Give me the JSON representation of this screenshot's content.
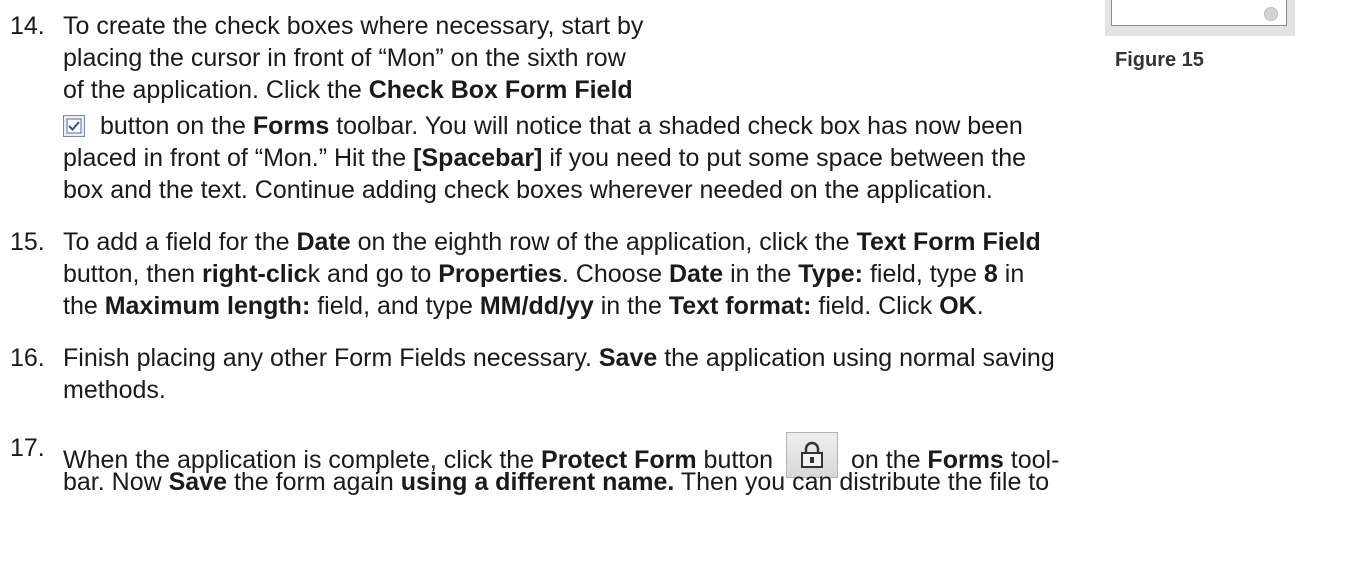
{
  "figure": {
    "caption": "Figure 15"
  },
  "steps": [
    {
      "number": "14.",
      "lines": [
        [
          "To create the check boxes where necessary, start by"
        ],
        [
          "placing the cursor in front of “Mon” on the sixth row"
        ],
        [
          "of the application. Click the ",
          "Check Box Form Field"
        ],
        [
          " button on the ",
          "Forms",
          " toolbar. You will notice that a shaded check box has now been"
        ],
        [
          "placed in front of “Mon.” Hit the ",
          "[Spacebar]",
          " if you need to put some space between the"
        ],
        [
          "box and the text. Continue adding check boxes wherever needed on the application."
        ]
      ]
    },
    {
      "number": "15.",
      "lines": [
        [
          "To add a field for the ",
          "Date",
          " on the eighth row of the application, click the ",
          "Text Form Field"
        ],
        [
          "button, then ",
          "right-clic",
          "k and go to ",
          "Properties",
          ". Choose ",
          "Date",
          " in the ",
          "Type:",
          " field, type ",
          "8",
          " in"
        ],
        [
          "the ",
          "Maximum length:",
          " field, and type ",
          "MM/dd/yy",
          " in the ",
          "Text format:",
          " field. Click ",
          "OK",
          "."
        ]
      ]
    },
    {
      "number": "16.",
      "lines": [
        [
          "Finish placing any other Form Fields necessary. ",
          "Save",
          " the application using normal saving"
        ],
        [
          "methods."
        ]
      ]
    },
    {
      "number": "17.",
      "lines": [
        [
          "When the application is complete, click the ",
          "Protect Form",
          " button ",
          "",
          " on the ",
          "Forms",
          " tool-"
        ],
        [
          "bar. Now ",
          "Save",
          " the form again ",
          "using a different name.",
          " Then you can distribute the file to"
        ]
      ]
    }
  ],
  "icons": {
    "checkbox_button": "checkbox-form-field-icon",
    "protect_button": "protect-form-lock-icon"
  }
}
